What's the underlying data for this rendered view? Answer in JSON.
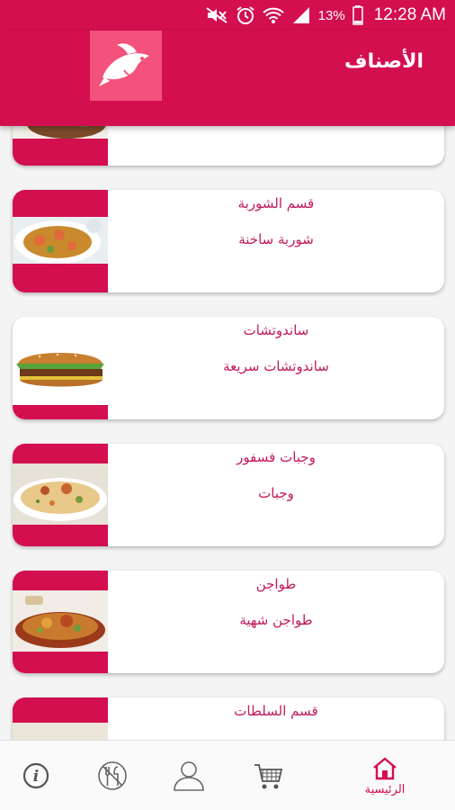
{
  "status_bar": {
    "battery_percent": "13%",
    "time": "12:28 AM",
    "icons": [
      "mute-icon",
      "alarm-icon",
      "wifi-icon",
      "signal-icon",
      "battery-icon"
    ]
  },
  "app_bar": {
    "title": "الأصناف",
    "logo_icon": "fish-logo-icon"
  },
  "categories": [
    {
      "name": "",
      "description": "",
      "image": "food-image"
    },
    {
      "name": "قسم الشوربة",
      "description": "شوربة ساخنة",
      "image": "soup-image"
    },
    {
      "name": "ساندوتشات",
      "description": "ساندوتشات سريعة",
      "image": "sandwich-image"
    },
    {
      "name": "وجبات فسفور",
      "description": "وجبات",
      "image": "meal-image"
    },
    {
      "name": "طواجن",
      "description": "طواجن شهية",
      "image": "tagine-image"
    },
    {
      "name": "قسم السلطات",
      "description": "",
      "image": "salad-image"
    }
  ],
  "bottom_nav": {
    "home_label": "الرئيسية",
    "items": [
      "info-icon",
      "no-food-icon",
      "profile-icon",
      "cart-icon",
      "home-icon"
    ]
  },
  "colors": {
    "primary": "#d30f4f",
    "logo_bg": "#f2527b",
    "text_accent": "#c2185b"
  }
}
